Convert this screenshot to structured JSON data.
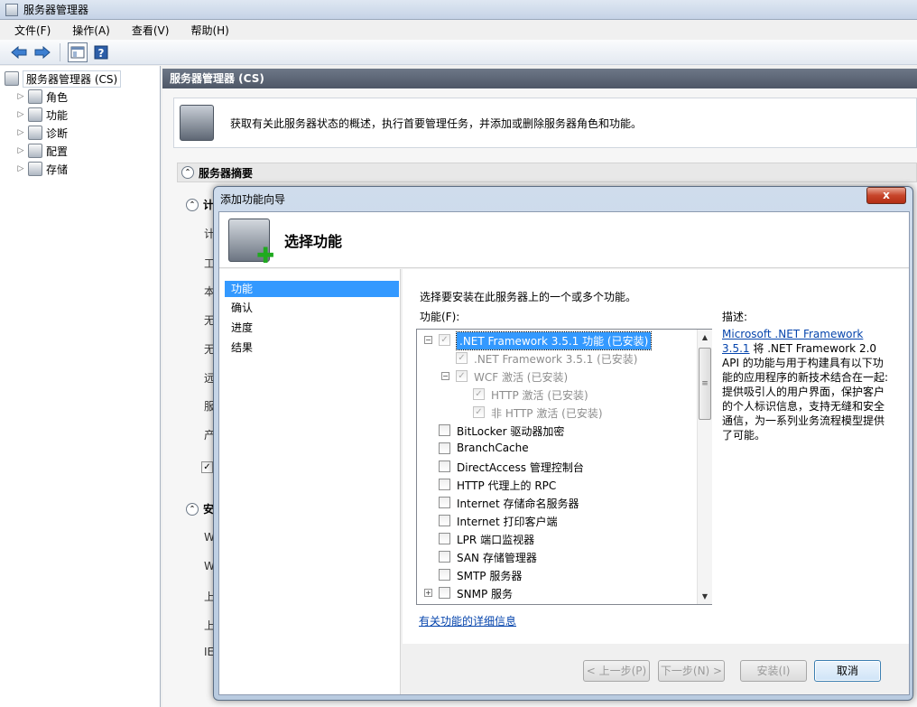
{
  "window": {
    "title": "服务器管理器"
  },
  "menu": [
    "文件(F)",
    "操作(A)",
    "查看(V)",
    "帮助(H)"
  ],
  "tree": {
    "root": "服务器管理器 (CS)",
    "items": [
      "角色",
      "功能",
      "诊断",
      "配置",
      "存储"
    ]
  },
  "main": {
    "header": "服务器管理器 (CS)",
    "intro": "获取有关此服务器状态的概述，执行首要管理任务，并添加或删除服务器角色和功能。",
    "section_summary": "服务器摘要",
    "section_computer": "计",
    "stubs": [
      "计",
      "工",
      "本",
      "无",
      "无",
      "远",
      "服",
      "产"
    ],
    "section_security": "安",
    "stubs2": [
      "W",
      "W",
      "上",
      "上",
      "IE"
    ]
  },
  "dialog": {
    "title": "添加功能向导",
    "close": "x",
    "heading": "选择功能",
    "steps": [
      "功能",
      "确认",
      "进度",
      "结果"
    ],
    "active_step": 0,
    "instruction": "选择要安装在此服务器上的一个或多个功能。",
    "features_label": "功能(F):",
    "description_label": "描述:",
    "description_link": "Microsoft .NET Framework 3.5.1",
    "description_text": "将 .NET Framework 2.0 API 的功能与用于构建具有以下功能的应用程序的新技术结合在一起: 提供吸引人的用户界面，保护客户的个人标识信息，支持无缝和安全通信，为一系列业务流程模型提供了可能。",
    "features": [
      {
        "label": ".NET Framework 3.5.1 功能  (已安装)",
        "indent": 0,
        "expander": "minus",
        "checked": true,
        "disabled": true,
        "selected": true
      },
      {
        "label": ".NET Framework 3.5.1  (已安装)",
        "indent": 1,
        "expander": "",
        "checked": true,
        "disabled": true,
        "selected": false
      },
      {
        "label": "WCF 激活  (已安装)",
        "indent": 1,
        "expander": "minus",
        "checked": true,
        "disabled": true,
        "selected": false
      },
      {
        "label": "HTTP 激活  (已安装)",
        "indent": 2,
        "expander": "",
        "checked": true,
        "disabled": true,
        "selected": false
      },
      {
        "label": "非 HTTP 激活  (已安装)",
        "indent": 2,
        "expander": "",
        "checked": true,
        "disabled": true,
        "selected": false
      },
      {
        "label": "BitLocker 驱动器加密",
        "indent": 0,
        "expander": "",
        "checked": false,
        "disabled": false,
        "selected": false
      },
      {
        "label": "BranchCache",
        "indent": 0,
        "expander": "",
        "checked": false,
        "disabled": false,
        "selected": false
      },
      {
        "label": "DirectAccess 管理控制台",
        "indent": 0,
        "expander": "",
        "checked": false,
        "disabled": false,
        "selected": false
      },
      {
        "label": "HTTP 代理上的 RPC",
        "indent": 0,
        "expander": "",
        "checked": false,
        "disabled": false,
        "selected": false
      },
      {
        "label": "Internet 存储命名服务器",
        "indent": 0,
        "expander": "",
        "checked": false,
        "disabled": false,
        "selected": false
      },
      {
        "label": "Internet 打印客户端",
        "indent": 0,
        "expander": "",
        "checked": false,
        "disabled": false,
        "selected": false
      },
      {
        "label": "LPR 端口监视器",
        "indent": 0,
        "expander": "",
        "checked": false,
        "disabled": false,
        "selected": false
      },
      {
        "label": "SAN 存储管理器",
        "indent": 0,
        "expander": "",
        "checked": false,
        "disabled": false,
        "selected": false
      },
      {
        "label": "SMTP 服务器",
        "indent": 0,
        "expander": "",
        "checked": false,
        "disabled": false,
        "selected": false
      },
      {
        "label": "SNMP 服务",
        "indent": 0,
        "expander": "plus",
        "checked": false,
        "disabled": false,
        "selected": false
      }
    ],
    "more_info_link": "有关功能的详细信息",
    "buttons": {
      "prev": "< 上一步(P)",
      "next": "下一步(N) >",
      "install": "安装(I)",
      "cancel": "取消"
    }
  }
}
